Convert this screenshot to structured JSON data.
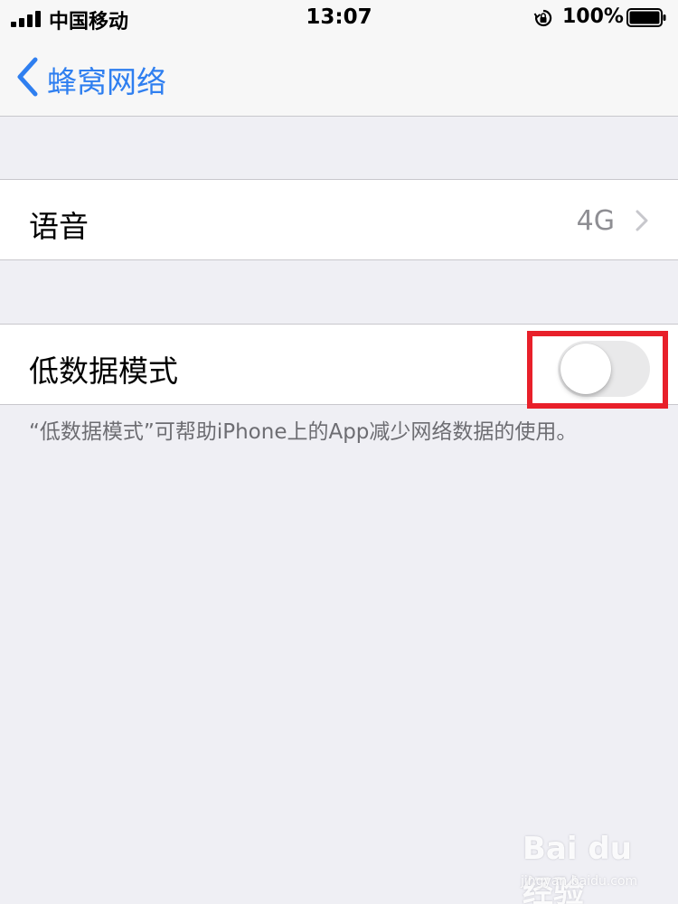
{
  "status_bar": {
    "carrier": "中国移动",
    "time": "13:07",
    "battery_percent": "100%",
    "signal_bars": 4,
    "battery_level": 1.0,
    "icons": [
      "signal-icon",
      "rotation-lock-icon",
      "battery-icon"
    ]
  },
  "nav": {
    "back_label": "蜂窝网络",
    "back_icon": "chevron-left-icon"
  },
  "voice_row": {
    "label": "语音",
    "value": "4G",
    "icon": "chevron-right-icon"
  },
  "low_data_row": {
    "label": "低数据模式",
    "toggle_on": false
  },
  "footer": {
    "note": "“低数据模式”可帮助iPhone上的App减少网络数据的使用。"
  },
  "watermark": {
    "logo": "Bai du 经验",
    "url": "jingyan.baidu.com"
  },
  "colors": {
    "accent": "#2f7ff0",
    "background": "#efeff4",
    "highlight": "#e8202a",
    "secondary_text": "#8e8e93"
  }
}
